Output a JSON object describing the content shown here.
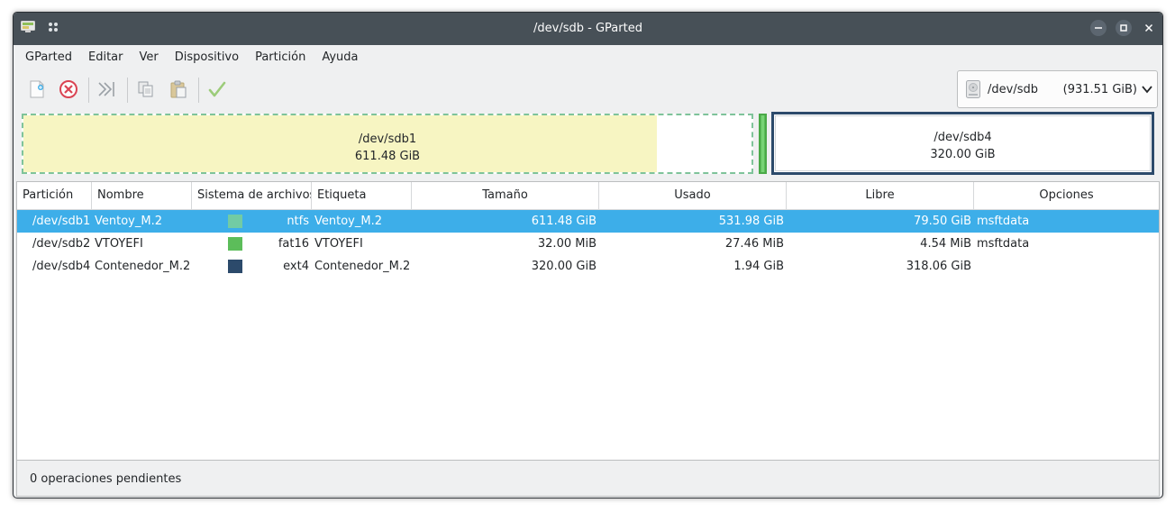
{
  "window": {
    "title": "/dev/sdb - GParted"
  },
  "menu": [
    "GParted",
    "Editar",
    "Ver",
    "Dispositivo",
    "Partición",
    "Ayuda"
  ],
  "toolbar": {
    "icons": [
      "new-partition-icon",
      "delete-partition-icon",
      "resize-move-icon",
      "copy-icon",
      "paste-icon",
      "apply-operations-icon"
    ]
  },
  "device": {
    "name": "/dev/sdb",
    "size": "(931.51 GiB)"
  },
  "diskmap": {
    "sdb1": {
      "name": "/dev/sdb1",
      "size": "611.48 GiB",
      "used_fraction": 0.87
    },
    "sdb4": {
      "name": "/dev/sdb4",
      "size": "320.00 GiB"
    }
  },
  "table": {
    "headers": [
      "Partición",
      "Nombre",
      "Sistema de archivos",
      "Etiqueta",
      "Tamaño",
      "Usado",
      "Libre",
      "Opciones"
    ],
    "rows": [
      {
        "particion": "/dev/sdb1",
        "nombre": "Ventoy_M.2",
        "fs": "ntfs",
        "fs_color": "#72cba4",
        "etiqueta": "Ventoy_M.2",
        "tamano": "611.48 GiB",
        "usado": "531.98 GiB",
        "libre": "79.50 GiB",
        "opciones": "msftdata"
      },
      {
        "particion": "/dev/sdb2",
        "nombre": "VTOYEFI",
        "fs": "fat16",
        "fs_color": "#5cbd5a",
        "etiqueta": "VTOYEFI",
        "tamano": "32.00 MiB",
        "usado": "27.46 MiB",
        "libre": "4.54 MiB",
        "opciones": "msftdata"
      },
      {
        "particion": "/dev/sdb4",
        "nombre": "Contenedor_M.2",
        "fs": "ext4",
        "fs_color": "#2c4a6b",
        "etiqueta": "Contenedor_M.2",
        "tamano": "320.00 GiB",
        "usado": "1.94 GiB",
        "libre": "318.06 GiB",
        "opciones": ""
      }
    ]
  },
  "status": {
    "text": "0 operaciones pendientes"
  }
}
